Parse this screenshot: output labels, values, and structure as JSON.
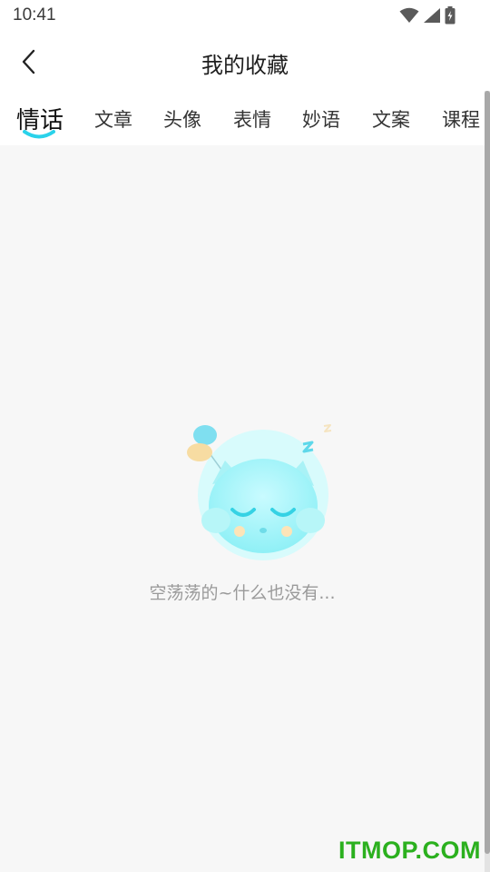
{
  "status_bar": {
    "time": "10:41",
    "icons": [
      "wifi-icon",
      "signal-icon",
      "battery-charging-icon"
    ]
  },
  "header": {
    "back_icon": "chevron-left-icon",
    "title": "我的收藏"
  },
  "tabs": [
    {
      "label": "情话",
      "active": true
    },
    {
      "label": "文章",
      "active": false
    },
    {
      "label": "头像",
      "active": false
    },
    {
      "label": "表情",
      "active": false
    },
    {
      "label": "妙语",
      "active": false
    },
    {
      "label": "文案",
      "active": false
    },
    {
      "label": "课程",
      "active": false
    }
  ],
  "colors": {
    "accent": "#2ad2ea",
    "watermark": "#2bb01e"
  },
  "empty_state": {
    "illustration": "sleeping-cat-balloon-illustration",
    "message": "空荡荡的~什么也没有..."
  },
  "watermark": {
    "text": "ITMOP.COM"
  }
}
